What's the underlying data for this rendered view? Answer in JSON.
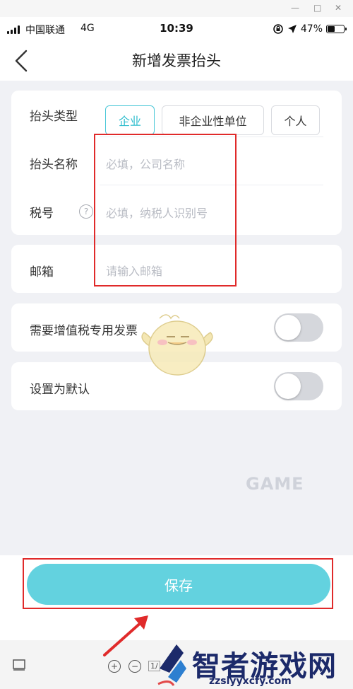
{
  "window_controls": {
    "minimize": "—",
    "maximize": "□",
    "close": "✕"
  },
  "status_bar": {
    "carrier": "中国联通",
    "network": "4G",
    "time": "10:39",
    "battery": "47%",
    "battery_level": 0.47
  },
  "nav": {
    "title": "新增发票抬头",
    "back_icon": "chevron-left-icon"
  },
  "invoice_form": {
    "type_label": "抬头类型",
    "type_options": [
      "企业",
      "非企业性单位",
      "个人"
    ],
    "selected_type": "企业",
    "name_label": "抬头名称",
    "name_placeholder": "必填，公司名称",
    "tax_label": "税号",
    "tax_help_icon": "?",
    "tax_placeholder": "必填，纳税人识别号"
  },
  "email_section": {
    "label": "邮箱",
    "placeholder": "请输入邮箱"
  },
  "vat_toggle": {
    "label": "需要增值税专用发票",
    "on": false
  },
  "default_toggle": {
    "label": "设置为默认",
    "on": false
  },
  "save_button": {
    "label": "保存"
  },
  "doc_toolbar": {
    "zoom_in": "+",
    "zoom_out": "−",
    "page": "1/"
  },
  "watermark": {
    "brand": "智者游戏网",
    "url": "zzslyyxcfy.com",
    "overlay": "GAME"
  },
  "colors": {
    "accent": "#63d2df",
    "selected_border": "#4dc8d8",
    "annotation_red": "#e02a2a"
  }
}
